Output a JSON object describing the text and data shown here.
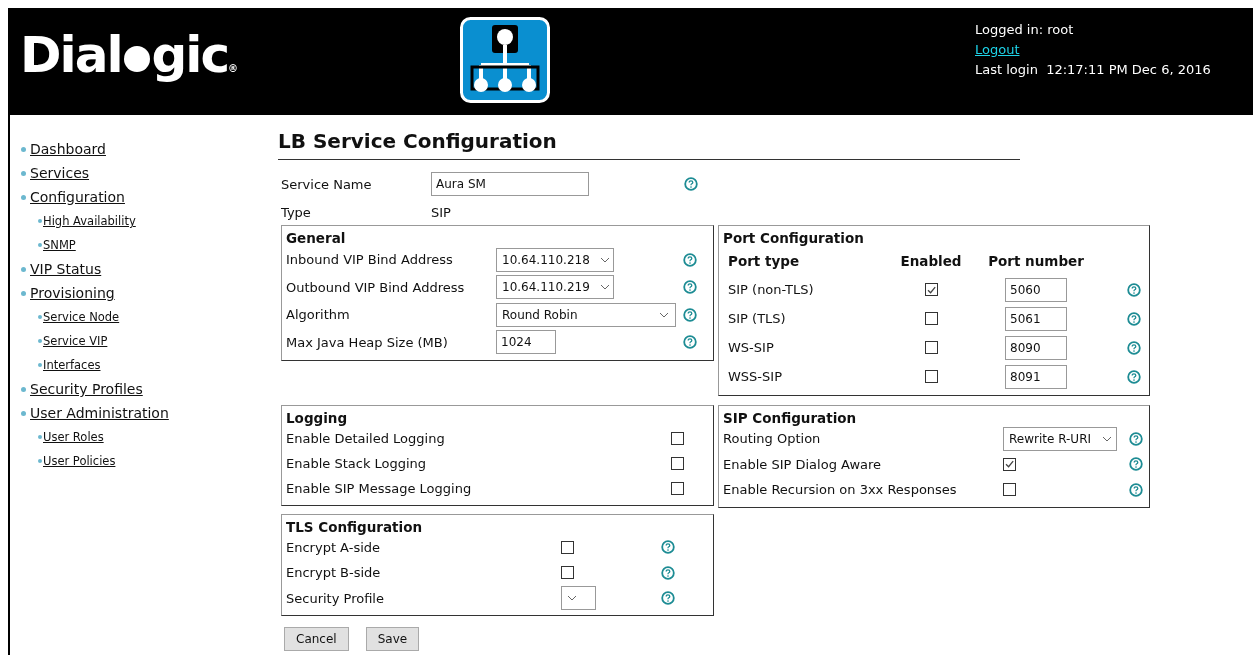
{
  "header": {
    "brand": "Dial",
    "brand_rest": "gic",
    "brand_mark": "®",
    "logged_in": "Logged in: root",
    "logout": "Logout",
    "last_login_label": "Last login",
    "last_login": "12:17:11 PM Dec 6, 2016"
  },
  "sidebar": {
    "items": [
      {
        "label": "Dashboard"
      },
      {
        "label": "Services"
      },
      {
        "label": "Configuration",
        "children": [
          {
            "label": "High Availability"
          },
          {
            "label": "SNMP"
          }
        ]
      },
      {
        "label": "VIP Status"
      },
      {
        "label": "Provisioning",
        "children": [
          {
            "label": "Service Node"
          },
          {
            "label": "Service VIP"
          },
          {
            "label": "Interfaces"
          }
        ]
      },
      {
        "label": "Security Profiles"
      },
      {
        "label": "User Administration",
        "children": [
          {
            "label": "User Roles"
          },
          {
            "label": "User Policies"
          }
        ]
      }
    ]
  },
  "form": {
    "title": "LB Service Configuration",
    "service_name": {
      "label": "Service Name",
      "value": "Aura SM",
      "help": true
    },
    "type": {
      "label": "Type",
      "value": "SIP"
    },
    "general": {
      "title": "General",
      "rows": [
        {
          "kind": "select",
          "label": "Inbound VIP Bind Address",
          "value": "10.64.110.218",
          "help": true
        },
        {
          "kind": "select",
          "label": "Outbound VIP Bind Address",
          "value": "10.64.110.219",
          "help": true
        },
        {
          "kind": "select",
          "label": "Algorithm",
          "value": "Round Robin",
          "help": true
        },
        {
          "kind": "input",
          "label": "Max Java Heap Size (MB)",
          "value": "1024",
          "help": true
        }
      ]
    },
    "port_configuration": {
      "title": "Port Configuration",
      "columns": [
        "Port type",
        "Enabled",
        "Port number"
      ],
      "rows": [
        {
          "type": "SIP (non-TLS)",
          "enabled": true,
          "port": "5060",
          "help": true
        },
        {
          "type": "SIP (TLS)",
          "enabled": false,
          "port": "5061",
          "help": true
        },
        {
          "type": "WS-SIP",
          "enabled": false,
          "port": "8090",
          "help": true
        },
        {
          "type": "WSS-SIP",
          "enabled": false,
          "port": "8091",
          "help": true
        }
      ]
    },
    "logging": {
      "title": "Logging",
      "rows": [
        {
          "kind": "checkbox",
          "label": "Enable Detailed Logging",
          "checked": false
        },
        {
          "kind": "checkbox",
          "label": "Enable Stack Logging",
          "checked": false
        },
        {
          "kind": "checkbox",
          "label": "Enable SIP Message Logging",
          "checked": false
        }
      ]
    },
    "sip_configuration": {
      "title": "SIP Configuration",
      "rows": [
        {
          "kind": "select",
          "label": "Routing Option",
          "value": "Rewrite R-URI",
          "help": true
        },
        {
          "kind": "checkbox",
          "label": "Enable SIP Dialog Aware",
          "checked": true,
          "help": true
        },
        {
          "kind": "checkbox",
          "label": "Enable Recursion on 3xx Responses",
          "checked": false,
          "help": true
        }
      ]
    },
    "tls_configuration": {
      "title": "TLS Configuration",
      "rows": [
        {
          "kind": "checkbox",
          "label": "Encrypt A-side",
          "checked": false,
          "help": true
        },
        {
          "kind": "checkbox",
          "label": "Encrypt B-side",
          "checked": false,
          "help": true
        },
        {
          "kind": "select",
          "label": "Security Profile",
          "value": "",
          "help": true
        }
      ]
    },
    "buttons": [
      "Cancel",
      "Save"
    ]
  }
}
